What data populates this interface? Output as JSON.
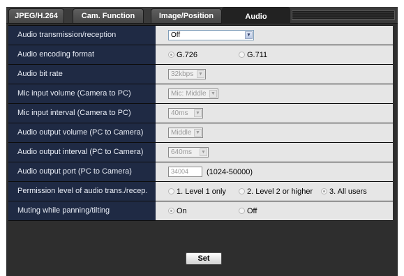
{
  "tabs": [
    {
      "label": "JPEG/H.264",
      "active": false
    },
    {
      "label": "Cam. Function",
      "active": false
    },
    {
      "label": "Image/Position",
      "active": false
    },
    {
      "label": "Audio",
      "active": true
    }
  ],
  "rows": {
    "transmission": {
      "label": "Audio transmission/reception",
      "value": "Off"
    },
    "encoding": {
      "label": "Audio encoding format",
      "options": [
        "G.726",
        "G.711"
      ],
      "selected": "G.726"
    },
    "bitrate": {
      "label": "Audio bit rate",
      "value": "32kbps"
    },
    "mic_volume": {
      "label": "Mic input volume (Camera to PC)",
      "value": "Mic: Middle"
    },
    "mic_interval": {
      "label": "Mic input interval (Camera to PC)",
      "value": "40ms"
    },
    "out_volume": {
      "label": "Audio output volume (PC to Camera)",
      "value": "Middle"
    },
    "out_interval": {
      "label": "Audio output interval (PC to Camera)",
      "value": "640ms"
    },
    "out_port": {
      "label": "Audio output port (PC to Camera)",
      "value": "34004",
      "range": "(1024-50000)"
    },
    "permission": {
      "label": "Permission level of audio trans./recep.",
      "options": [
        "1. Level 1 only",
        "2. Level 2 or higher",
        "3. All users"
      ],
      "selected": "3. All users"
    },
    "muting": {
      "label": "Muting while panning/tilting",
      "options": [
        "On",
        "Off"
      ],
      "selected": "On"
    }
  },
  "buttons": {
    "set": "Set"
  },
  "icons": {
    "dropdown": "chevron-down-icon",
    "radio": "radio-icon"
  },
  "colors": {
    "label_bg": "#1f2a44",
    "value_bg": "#e6e6e6",
    "panel_bg": "#2e2e2e"
  }
}
